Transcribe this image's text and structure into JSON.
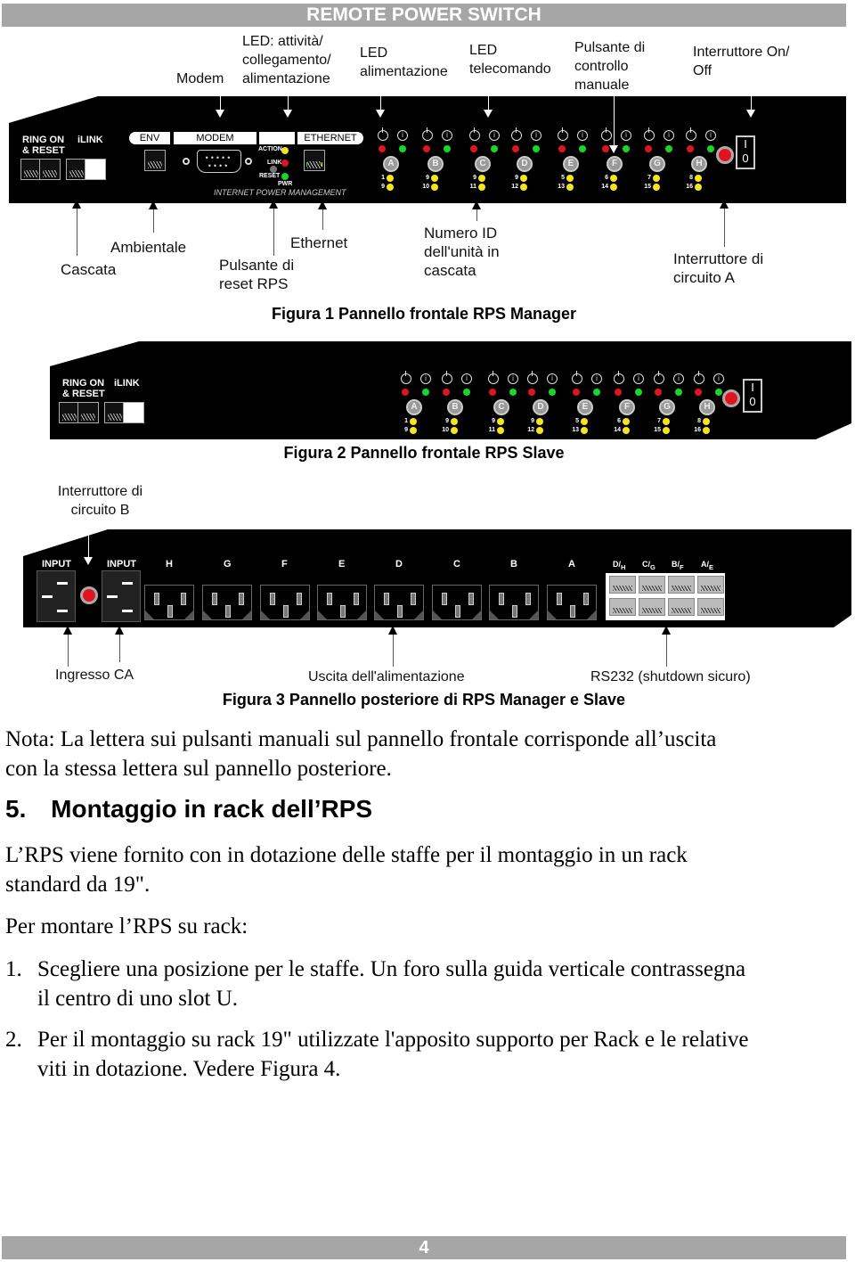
{
  "header_banner": "REMOTE POWER SWITCH",
  "footer_page_number": "4",
  "figure1": {
    "top_labels": {
      "modem": "Modem",
      "led_activity": [
        "LED: attività/",
        "collegamento/",
        "alimentazione"
      ],
      "led_power": [
        "LED",
        "alimentazione"
      ],
      "led_remote": [
        "LED",
        "telecomando"
      ],
      "manual_button": [
        "Pulsante di",
        "controllo",
        "manuale"
      ],
      "on_off": [
        "Interruttore On/",
        "Off"
      ]
    },
    "panel": {
      "ring_on": [
        "RING ON",
        "& RESET"
      ],
      "ilink": "iLINK",
      "env": "ENV",
      "modem": "MODEM",
      "ethernet": "ETHERNET",
      "action": "ACTION",
      "link": "LINK",
      "reset": "RESET",
      "pwr": "PWR",
      "ipm": "INTERNET POWER MANAGEMENT"
    },
    "bottom_labels": {
      "cascata": "Cascata",
      "ambientale": "Ambientale",
      "reset_rps": [
        "Pulsante di",
        "reset RPS"
      ],
      "ethernet": "Ethernet",
      "id_number": [
        "Numero ID",
        "dell'unità in",
        "cascata"
      ],
      "breaker_a": [
        "Interruttore di",
        "circuito A"
      ]
    },
    "caption": "Figura 1 Pannello frontale RPS Manager"
  },
  "outlet_groups": [
    {
      "letter": "A",
      "n1": "1",
      "n2": "9"
    },
    {
      "letter": "B",
      "n1": "9",
      "n2": "10"
    },
    {
      "letter": "C",
      "n1": "9",
      "n2": "11"
    },
    {
      "letter": "D",
      "n1": "9",
      "n2": "12"
    },
    {
      "letter": "E",
      "n1": "5",
      "n2": "13"
    },
    {
      "letter": "F",
      "n1": "6",
      "n2": "14"
    },
    {
      "letter": "G",
      "n1": "7",
      "n2": "15"
    },
    {
      "letter": "H",
      "n1": "8",
      "n2": "16"
    }
  ],
  "switch_glyphs": {
    "on": "I",
    "off": "0"
  },
  "figure2": {
    "ring_on": [
      "RING ON",
      "& RESET"
    ],
    "ilink": "iLINK",
    "caption": "Figura 2 Pannello frontale RPS Slave",
    "breaker_b": [
      "Interruttore di",
      "circuito B"
    ]
  },
  "figure3": {
    "input1": "INPUT",
    "input2": "INPUT",
    "outlets": [
      "H",
      "G",
      "F",
      "E",
      "D",
      "C",
      "B",
      "A"
    ],
    "rs232_ports": [
      {
        "top": "D",
        "sub": "H"
      },
      {
        "top": "C",
        "sub": "G"
      },
      {
        "top": "B",
        "sub": "F"
      },
      {
        "top": "A",
        "sub": "E"
      }
    ],
    "labels": {
      "ac_input": "Ingresso CA",
      "power_output": "Uscita dell'alimentazione",
      "rs232": "RS232 (shutdown sicuro)"
    },
    "caption": "Figura 3 Pannello posteriore di RPS Manager e Slave"
  },
  "body": {
    "note": [
      "Nota: La lettera sui pulsanti manuali sul pannello frontale corrisponde all’uscita",
      "con la stessa lettera sul pannello posteriore."
    ],
    "section_number": "5.",
    "section_title": "Montaggio in rack dell’RPS",
    "intro": [
      "L’RPS viene fornito con in dotazione delle staffe per il montaggio in un rack",
      "standard da 19\"."
    ],
    "lead_in": "Per montare l’RPS su rack:",
    "steps": [
      {
        "num": "1.",
        "lines": [
          "Scegliere una posizione per le staffe. Un foro sulla guida verticale contrassegna",
          "il centro di uno slot U."
        ]
      },
      {
        "num": "2.",
        "lines": [
          "Per il montaggio su rack 19\" utilizzate l'apposito supporto per Rack e le relative",
          "viti in dotazione. Vedere Figura 4."
        ]
      }
    ]
  }
}
